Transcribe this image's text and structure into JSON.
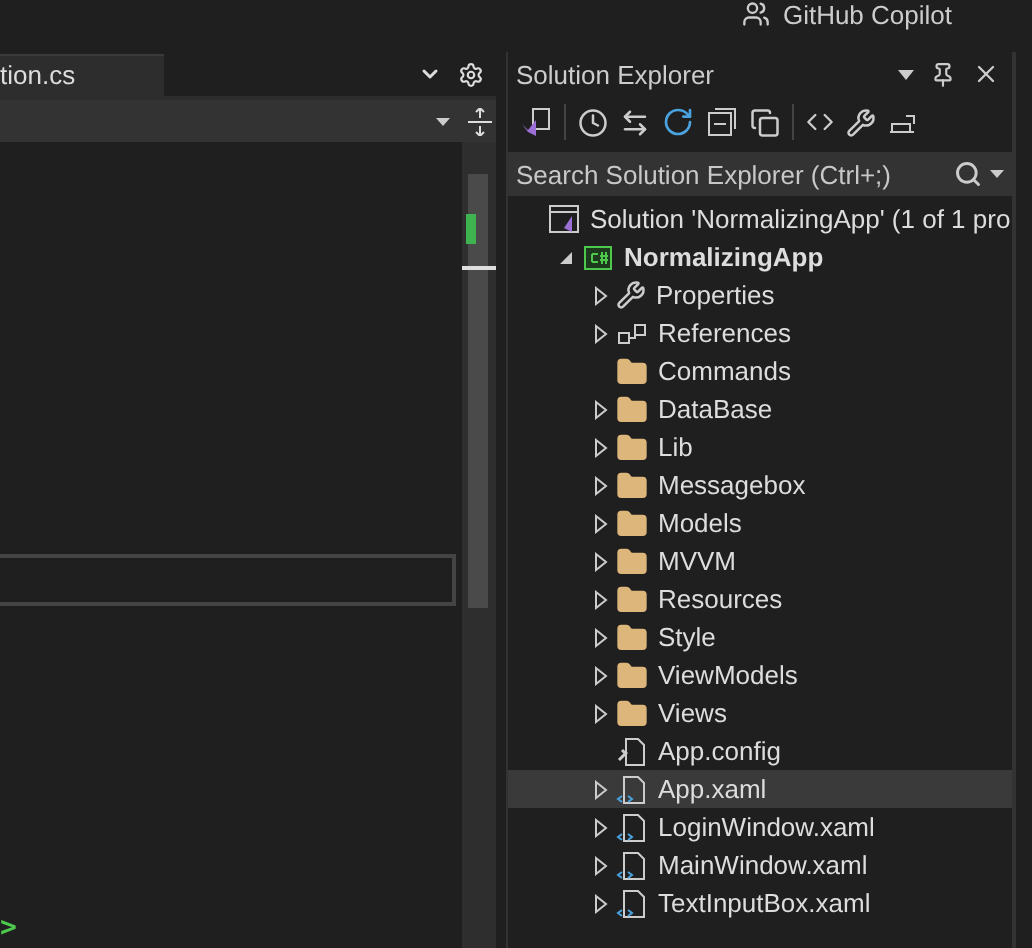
{
  "top_bar": {
    "copilot_label": "GitHub Copilot"
  },
  "editor": {
    "tab": {
      "label": "tion.cs",
      "selected": true
    },
    "code_fragment": ">"
  },
  "solution_explorer": {
    "title": "Solution Explorer",
    "search": {
      "placeholder": "Search Solution Explorer (Ctrl+;)"
    },
    "tree": [
      {
        "label": "Solution 'NormalizingApp' (1 of 1 pro",
        "kind": "solution",
        "expandable": false,
        "selected": false,
        "children": [
          {
            "label": "NormalizingApp",
            "kind": "project",
            "expandable": true,
            "expanded": true,
            "selected": false,
            "children": [
              {
                "label": "Properties",
                "kind": "properties",
                "expandable": true,
                "expanded": false,
                "selected": false
              },
              {
                "label": "References",
                "kind": "references",
                "expandable": true,
                "expanded": false,
                "selected": false
              },
              {
                "label": "Commands",
                "kind": "folder",
                "expandable": false,
                "expanded": false,
                "selected": false
              },
              {
                "label": "DataBase",
                "kind": "folder",
                "expandable": true,
                "expanded": false,
                "selected": false
              },
              {
                "label": "Lib",
                "kind": "folder",
                "expandable": true,
                "expanded": false,
                "selected": false
              },
              {
                "label": "Messagebox",
                "kind": "folder",
                "expandable": true,
                "expanded": false,
                "selected": false
              },
              {
                "label": "Models",
                "kind": "folder",
                "expandable": true,
                "expanded": false,
                "selected": false
              },
              {
                "label": "MVVM",
                "kind": "folder",
                "expandable": true,
                "expanded": false,
                "selected": false
              },
              {
                "label": "Resources",
                "kind": "folder",
                "expandable": true,
                "expanded": false,
                "selected": false
              },
              {
                "label": "Style",
                "kind": "folder",
                "expandable": true,
                "expanded": false,
                "selected": false
              },
              {
                "label": "ViewModels",
                "kind": "folder",
                "expandable": true,
                "expanded": false,
                "selected": false
              },
              {
                "label": "Views",
                "kind": "folder",
                "expandable": true,
                "expanded": false,
                "selected": false
              },
              {
                "label": "App.config",
                "kind": "config",
                "expandable": false,
                "expanded": false,
                "selected": false
              },
              {
                "label": "App.xaml",
                "kind": "xaml",
                "expandable": true,
                "expanded": false,
                "selected": true
              },
              {
                "label": "LoginWindow.xaml",
                "kind": "xaml",
                "expandable": true,
                "expanded": false,
                "selected": false
              },
              {
                "label": "MainWindow.xaml",
                "kind": "xaml",
                "expandable": true,
                "expanded": false,
                "selected": false
              },
              {
                "label": "TextInputBox.xaml",
                "kind": "xaml",
                "expandable": true,
                "expanded": false,
                "selected": false
              }
            ]
          }
        ]
      }
    ]
  }
}
